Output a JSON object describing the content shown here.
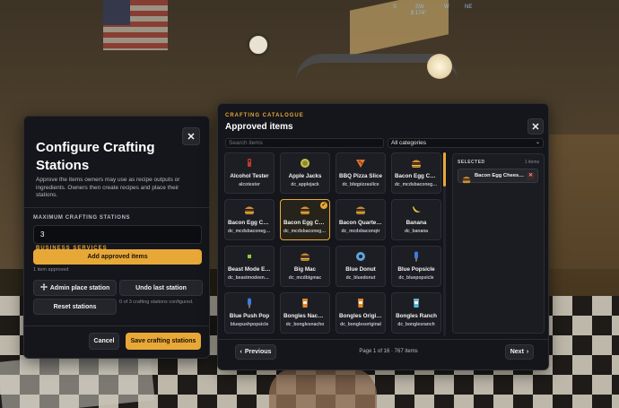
{
  "hud": {
    "compass": [
      "S",
      "SW",
      "W",
      "NE",
      "$ 174°"
    ]
  },
  "configure": {
    "eyebrow": "BUSINESS SERVICES",
    "title": "Configure Crafting Stations",
    "description": "Approve the items owners may use as recipe outputs or ingredients. Owners then create recipes and place their stations.",
    "max_label": "MAXIMUM CRAFTING STATIONS",
    "max_value": "3",
    "add_button": "Add approved items",
    "approved_note": "1 item approved",
    "admin_place": "Admin place station",
    "undo": "Undo last station",
    "reset": "Reset stations",
    "stations_note": "0 of 3 crafting stations configured.",
    "cancel": "Cancel",
    "save": "Save crafting stations",
    "close": "✕"
  },
  "catalogue": {
    "eyebrow": "CRAFTING CATALOGUE",
    "title": "Approved items",
    "search_placeholder": "Search items",
    "category": "All categories",
    "close": "✕",
    "items": [
      {
        "name": "Alcohol Tester",
        "code": "alcotester",
        "icon": "tester-icon",
        "color": "#c0392b"
      },
      {
        "name": "Apple Jacks",
        "code": "dc_applejack",
        "icon": "cereal-bowl-icon",
        "color": "#c7c246"
      },
      {
        "name": "BBQ Pizza Slice",
        "code": "dc_bbqpizzaslice",
        "icon": "pizza-icon",
        "color": "#d9772e"
      },
      {
        "name": "Bacon Egg Cheese Bagel",
        "code": "dc_mcdsbaconeggcheese",
        "icon": "sandwich-icon",
        "color": "#d9902e"
      },
      {
        "name": "Bacon Egg Cheese Biscuit",
        "code": "dc_mcdsbaconeggbiscuit",
        "icon": "sandwich-icon",
        "color": "#d9902e"
      },
      {
        "name": "Bacon Egg Cheese McGriddle",
        "code": "dc_mcdsbaconeggcheese",
        "icon": "sandwich-icon",
        "color": "#d9902e",
        "selected": true
      },
      {
        "name": "Bacon Quarter Pounder",
        "code": "dc_mcdsbaconqtr",
        "icon": "burger-icon",
        "color": "#c98a2e"
      },
      {
        "name": "Banana",
        "code": "dc_banana",
        "icon": "banana-icon",
        "color": "#e6cf3a"
      },
      {
        "name": "Beast Mode Energy",
        "code": "dc_beastmodeenergy",
        "icon": "can-icon",
        "color": "#8fcf3a"
      },
      {
        "name": "Big Mac",
        "code": "dc_mcdbigmac",
        "icon": "burger-icon",
        "color": "#c98a2e"
      },
      {
        "name": "Blue Donut",
        "code": "dc_bluedonut",
        "icon": "donut-icon",
        "color": "#5aa6e0"
      },
      {
        "name": "Blue Popsicle",
        "code": "dc_bluepopsicle",
        "icon": "popsicle-icon",
        "color": "#3d7be0"
      },
      {
        "name": "Blue Push Pop",
        "code": "bluepushpopsicle",
        "icon": "pushpop-icon",
        "color": "#3d7be0"
      },
      {
        "name": "Bongles Nacho Cheese",
        "code": "dc_bonglesnacho",
        "icon": "chips-icon",
        "color": "#e0892e"
      },
      {
        "name": "Bongles Original",
        "code": "dc_bonglesoriginal",
        "icon": "chips-icon",
        "color": "#e0892e"
      },
      {
        "name": "Bongles Ranch",
        "code": "dc_bonglesranch",
        "icon": "chips-icon",
        "color": "#5ab8d9"
      }
    ],
    "selected_header": "SELECTED",
    "selected_count": "1 items",
    "selected_items": [
      {
        "name": "Bacon Egg Cheese McGriddle",
        "remove": "✕"
      }
    ],
    "prev": "Previous",
    "next": "Next",
    "page_text": "Page 1 of 16 · 767 items"
  }
}
